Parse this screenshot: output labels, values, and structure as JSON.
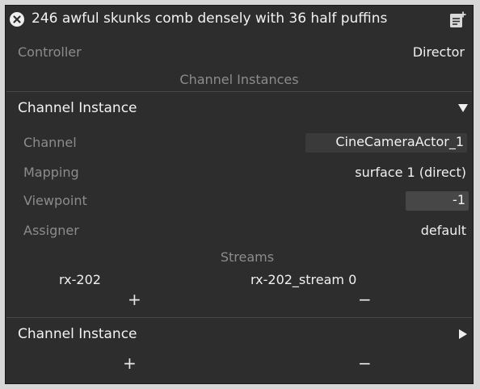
{
  "header": {
    "title": "246 awful skunks comb densely with 36 half puffins",
    "close_icon": "close-circle-icon",
    "edit_icon": "edit-note-icon"
  },
  "controller": {
    "label": "Controller",
    "value": "Director"
  },
  "channel_instances_heading": "Channel Instances",
  "instance_expanded": {
    "title": "Channel Instance",
    "expander_icon": "triangle-down-icon",
    "channel": {
      "label": "Channel",
      "value": "CineCameraActor_1"
    },
    "mapping": {
      "label": "Mapping",
      "value": "surface 1 (direct)"
    },
    "viewpoint": {
      "label": "Viewpoint",
      "value": "-1"
    },
    "assigner": {
      "label": "Assigner",
      "value": "default"
    },
    "streams": {
      "heading": "Streams",
      "rows": [
        {
          "name": "rx-202",
          "stream": "rx-202_stream 0"
        }
      ],
      "add_symbol": "+",
      "remove_symbol": "−"
    }
  },
  "instance_collapsed": {
    "title": "Channel Instance",
    "expander_icon": "triangle-right-icon"
  },
  "footer": {
    "add_symbol": "+",
    "remove_symbol": "−"
  },
  "colors": {
    "background": "#2d2d2d",
    "outer": "#d7d7d7",
    "label": "#8c8c8c",
    "text": "#f0f0f0",
    "field_bg": "#3a3a3a"
  }
}
